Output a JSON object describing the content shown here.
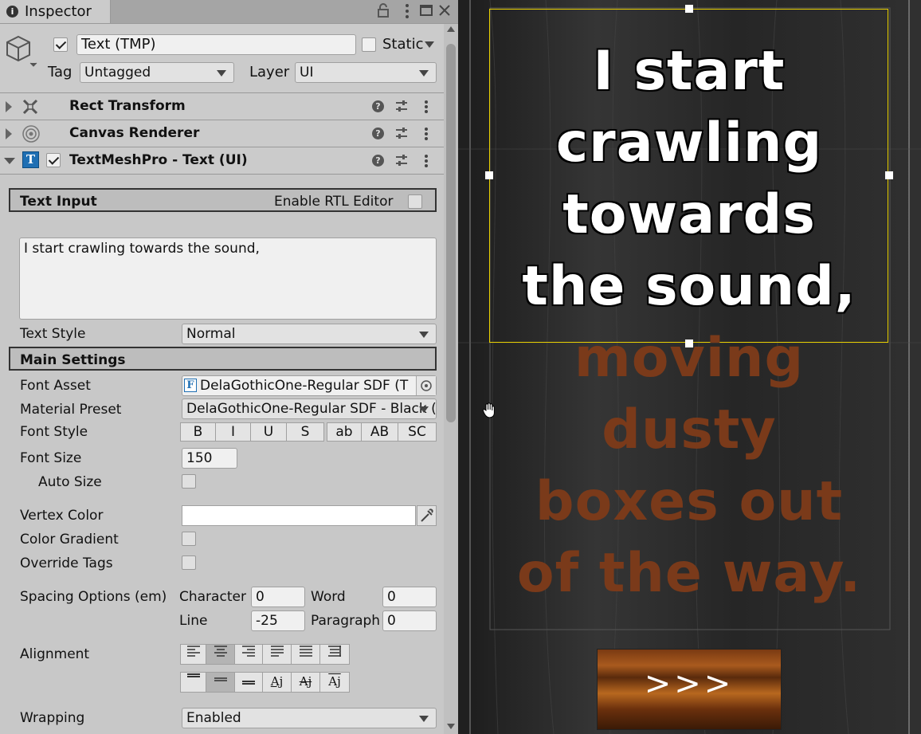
{
  "window": {
    "tab_label": "Inspector"
  },
  "object": {
    "name": "Text (TMP)",
    "static_label": "Static",
    "tag_label": "Tag",
    "tag_value": "Untagged",
    "layer_label": "Layer",
    "layer_value": "UI"
  },
  "components": [
    {
      "title": "Rect Transform",
      "icon": "rect-transform-icon"
    },
    {
      "title": "Canvas Renderer",
      "icon": "eye-icon"
    },
    {
      "title": "TextMeshPro - Text (UI)",
      "icon": "tmp-text-icon"
    }
  ],
  "text_input": {
    "section_title": "Text Input",
    "rtl_label": "Enable RTL Editor",
    "text_value": "I start crawling towards the sound,",
    "text_style_label": "Text Style",
    "text_style_value": "Normal"
  },
  "main_settings": {
    "section_title": "Main Settings",
    "font_asset_label": "Font Asset",
    "font_asset_value": "DelaGothicOne-Regular SDF (T",
    "material_preset_label": "Material Preset",
    "material_preset_value": "DelaGothicOne-Regular SDF - Black (",
    "font_style_label": "Font Style",
    "font_style_buttons": [
      "B",
      "I",
      "U",
      "S",
      "ab",
      "AB",
      "SC"
    ],
    "font_size_label": "Font Size",
    "font_size_value": "150",
    "auto_size_label": "Auto Size",
    "vertex_color_label": "Vertex Color",
    "color_gradient_label": "Color Gradient",
    "override_tags_label": "Override Tags",
    "spacing_label": "Spacing Options (em)",
    "character_label": "Character",
    "character_value": "0",
    "word_label": "Word",
    "word_value": "0",
    "line_label": "Line",
    "line_value": "-25",
    "paragraph_label": "Paragraph",
    "paragraph_value": "0",
    "alignment_label": "Alignment",
    "wrapping_label": "Wrapping",
    "wrapping_value": "Enabled"
  },
  "scene": {
    "white_lines": [
      "I start",
      "crawling",
      "towards",
      "the sound,"
    ],
    "brown_lines": [
      "moving",
      "dusty",
      "boxes out",
      "of the way."
    ],
    "button_label": ">>>",
    "colors": {
      "white_text": "#ffffff",
      "brown_text": "#7a3a1a",
      "selection": "#e8d000",
      "wood_bg": "#2a2a2a"
    }
  }
}
